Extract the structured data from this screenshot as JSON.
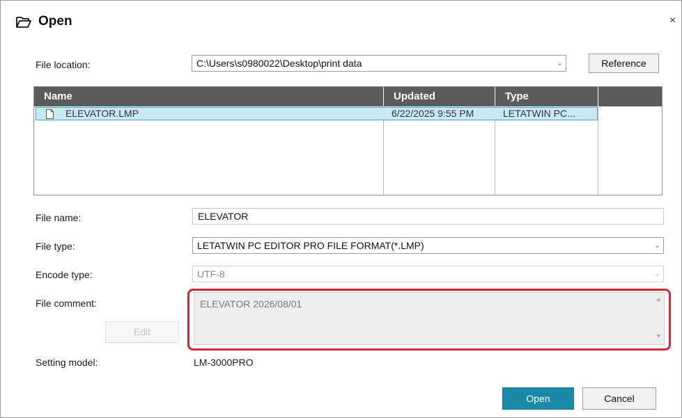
{
  "dialog": {
    "title": "Open",
    "icon": "folder-open-icon",
    "close_label": "×"
  },
  "file_location": {
    "label": "File location:",
    "value": "C:\\Users\\s0980022\\Desktop\\print data",
    "reference_button": "Reference"
  },
  "file_list": {
    "columns": [
      "Name",
      "Updated",
      "Type"
    ],
    "rows": [
      {
        "name": "ELEVATOR.LMP",
        "updated": "6/22/2025 9:55 PM",
        "type": "LETATWIN PC...",
        "icon": "file-icon",
        "selected": true
      }
    ]
  },
  "file_name": {
    "label": "File name:",
    "value": "ELEVATOR"
  },
  "file_type": {
    "label": "File type:",
    "value": "LETATWIN PC EDITOR PRO FILE FORMAT(*.LMP)"
  },
  "encode_type": {
    "label": "Encode type:",
    "value": "UTF-8",
    "enabled": false
  },
  "file_comment": {
    "label": "File comment:",
    "value": "ELEVATOR 2026/08/01",
    "edit_button": "Edit",
    "highlight_color": "#d32636"
  },
  "setting_model": {
    "label": "Setting model:",
    "value": "LM-3000PRO"
  },
  "actions": {
    "open": "Open",
    "cancel": "Cancel",
    "accent": "#1a8aa8"
  }
}
